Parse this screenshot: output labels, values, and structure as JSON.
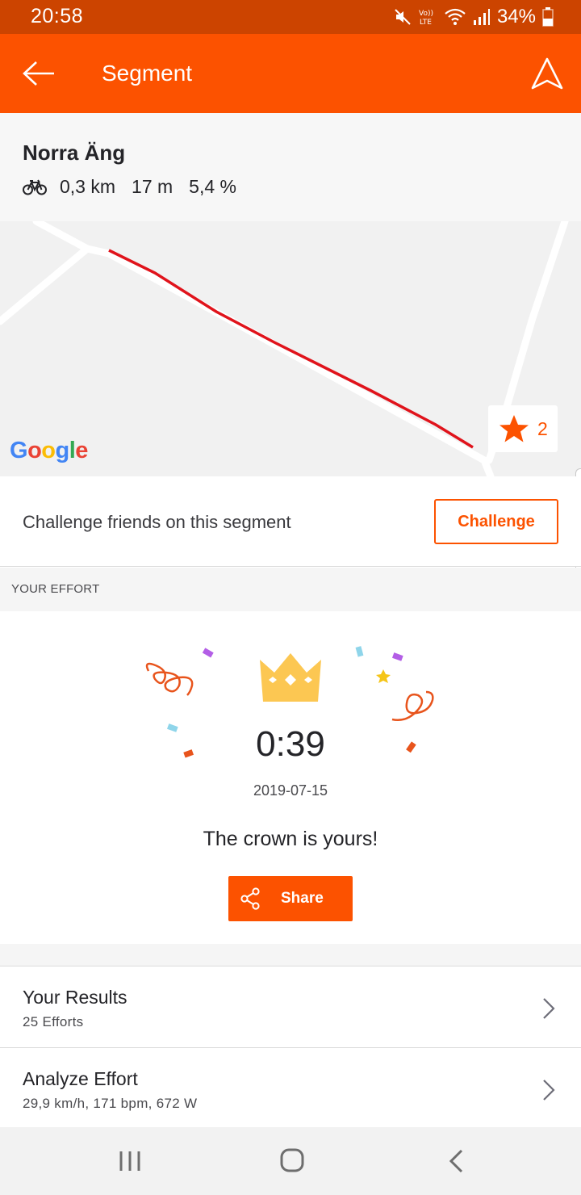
{
  "status_bar": {
    "time": "20:58",
    "battery_text": "34%",
    "icons": [
      "mute-icon",
      "volte-icon",
      "wifi-icon",
      "signal-icon",
      "battery-icon"
    ],
    "volte_label": "Vo)) LTE"
  },
  "app_bar": {
    "title": "Segment",
    "back_icon": "arrow-left-icon",
    "navigate_icon": "navigation-arrow-icon"
  },
  "segment": {
    "name": "Norra Äng",
    "sport_icon": "bicycle-icon",
    "distance": "0,3 km",
    "elevation": "17 m",
    "grade": "5,4 %"
  },
  "map": {
    "attribution": "Google",
    "star_count": "2",
    "route_color": "#e0131b"
  },
  "challenge": {
    "text": "Challenge friends on this segment",
    "button_label": "Challenge"
  },
  "your_effort": {
    "section_label": "YOUR EFFORT",
    "time": "0:39",
    "date": "2019-07-15",
    "message": "The crown is yours!",
    "share_label": "Share",
    "crown_icon": "crown-icon"
  },
  "list": {
    "results": {
      "title": "Your Results",
      "subtitle": "25 Efforts"
    },
    "analyze": {
      "title": "Analyze Effort",
      "subtitle": "29,9 km/h, 171 bpm, 672 W"
    }
  },
  "nav_bar": {
    "icons": [
      "recent-apps-icon",
      "home-icon",
      "back-icon"
    ]
  },
  "colors": {
    "brand": "#fc5200",
    "status_bar": "#cc4400",
    "crown": "#fcc752"
  }
}
